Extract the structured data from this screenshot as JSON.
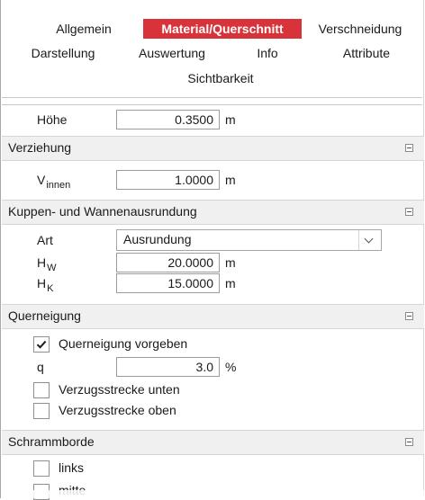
{
  "tabs": {
    "row1": [
      "Allgemein",
      "Material/Querschnitt",
      "Verschneidung"
    ],
    "row2": [
      "Darstellung",
      "Auswertung",
      "Info",
      "Attribute"
    ],
    "row3": [
      "Sichtbarkeit"
    ],
    "active": "Material/Querschnitt",
    "active_color": "#d8333a"
  },
  "hoehe": {
    "label": "Höhe",
    "value": "0.3500",
    "unit": "m"
  },
  "verziehung": {
    "title": "Verziehung",
    "v_label": "V",
    "v_sub": "innen",
    "v_value": "1.0000",
    "v_unit": "m"
  },
  "kuppen": {
    "title": "Kuppen- und Wannenausrundung",
    "art_label": "Art",
    "art_value": "Ausrundung",
    "hw_label": "H",
    "hw_sub": "W",
    "hw_value": "20.0000",
    "hw_unit": "m",
    "hk_label": "H",
    "hk_sub": "K",
    "hk_value": "15.0000",
    "hk_unit": "m"
  },
  "querneigung": {
    "title": "Querneigung",
    "vorgeben_label": "Querneigung vorgeben",
    "vorgeben_checked": true,
    "q_label": "q",
    "q_value": "3.0",
    "q_unit": "%",
    "unten_label": "Verzugsstrecke unten",
    "oben_label": "Verzugsstrecke oben"
  },
  "schrammborde": {
    "title": "Schrammborde",
    "links_label": "links",
    "mitte_label": "mitte"
  }
}
